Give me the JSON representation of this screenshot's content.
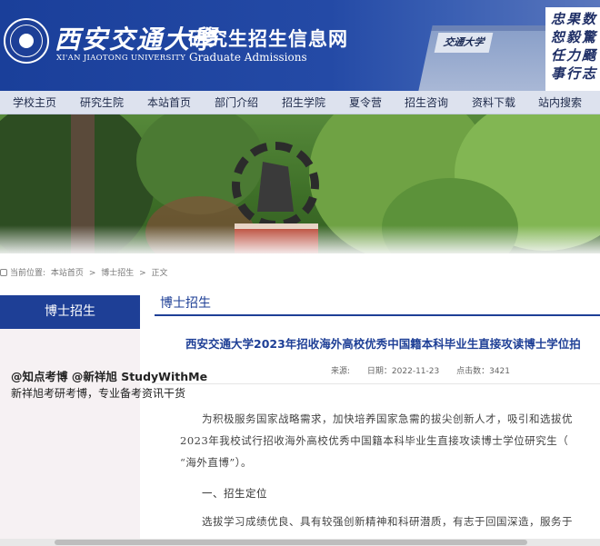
{
  "header": {
    "university_cn": "西安交通大學",
    "university_en": "XI'AN JIAOTONG UNIVERSITY",
    "site_title": "研究生招生信息网",
    "site_subtitle": "Graduate Admissions",
    "gate_plaque": "交通大学",
    "motto_lines": [
      "忠果数",
      "恕毅驚",
      "任力颾",
      "事行志"
    ]
  },
  "nav": {
    "items": [
      "学校主页",
      "研究生院",
      "本站首页",
      "部门介绍",
      "招生学院",
      "夏令营",
      "招生咨询",
      "资料下载",
      "站内搜索"
    ]
  },
  "breadcrumb": {
    "prefix": "当前位置:",
    "items": [
      "本站首页",
      "博士招生",
      "正文"
    ],
    "separator": ">"
  },
  "sidebar": {
    "heading": "博士招生"
  },
  "main": {
    "section_heading": "博士招生",
    "article_title": "西安交通大学2023年招收海外高校优秀中国籍本科毕业生直接攻读博士学位拍",
    "meta": {
      "source_label": "来源:",
      "date": "日期：2022-11-23",
      "views": "点击数：3421"
    },
    "paragraphs": [
      "为积极服务国家战略需求，加快培养国家急需的拔尖创新人才，吸引和选拔优",
      "2023年我校试行招收海外高校优秀中国籍本科毕业生直接攻读博士学位研究生（",
      "“海外直博”）。",
      "一、招生定位",
      "选拔学习成绩优良、具有较强创新精神和科研潜质，有志于回国深造，服务于"
    ]
  },
  "watermark": {
    "line1": "@知点考博  @新祥旭 StudyWithMe",
    "line2": "新祥旭考研考博，专业备考资讯干货"
  },
  "colors": {
    "brand_blue": "#1e3f96",
    "nav_bg": "#dde2ee"
  }
}
